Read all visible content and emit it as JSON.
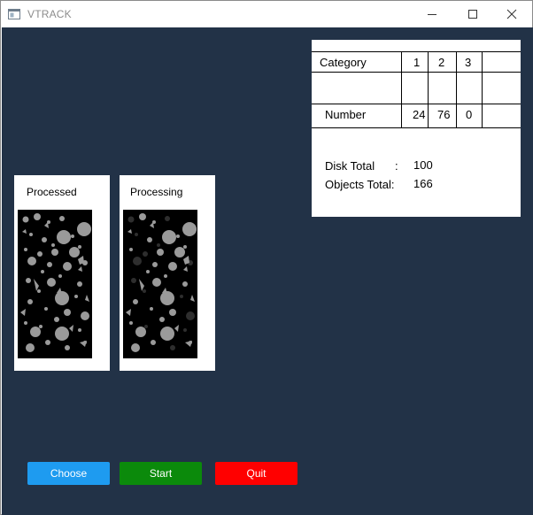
{
  "window": {
    "title": "VTRACK",
    "icon": "app-window-icon",
    "controls": {
      "minimize": "minimize-icon",
      "maximize": "maximize-icon",
      "close": "close-icon"
    }
  },
  "colors": {
    "background": "#223247",
    "choose": "#1e9bf0",
    "start": "#0b8a0b",
    "quit": "#ff0000",
    "blob": "#9a9a9a",
    "blob_dim": "#2e2e2e"
  },
  "processed": {
    "label": "Processed"
  },
  "processing": {
    "label": "Processing"
  },
  "stats": {
    "category_label": "Category",
    "categories": [
      "1",
      "2",
      "3"
    ],
    "number_label": "Number",
    "numbers": [
      "24",
      "76",
      "0"
    ],
    "disk_total_label": "Disk Total",
    "colon": ":",
    "disk_total_value": "100",
    "objects_total_label": "Objects Total:",
    "objects_total_value": "166"
  },
  "buttons": {
    "choose": "Choose",
    "start": "Start",
    "quit": "Quit"
  }
}
